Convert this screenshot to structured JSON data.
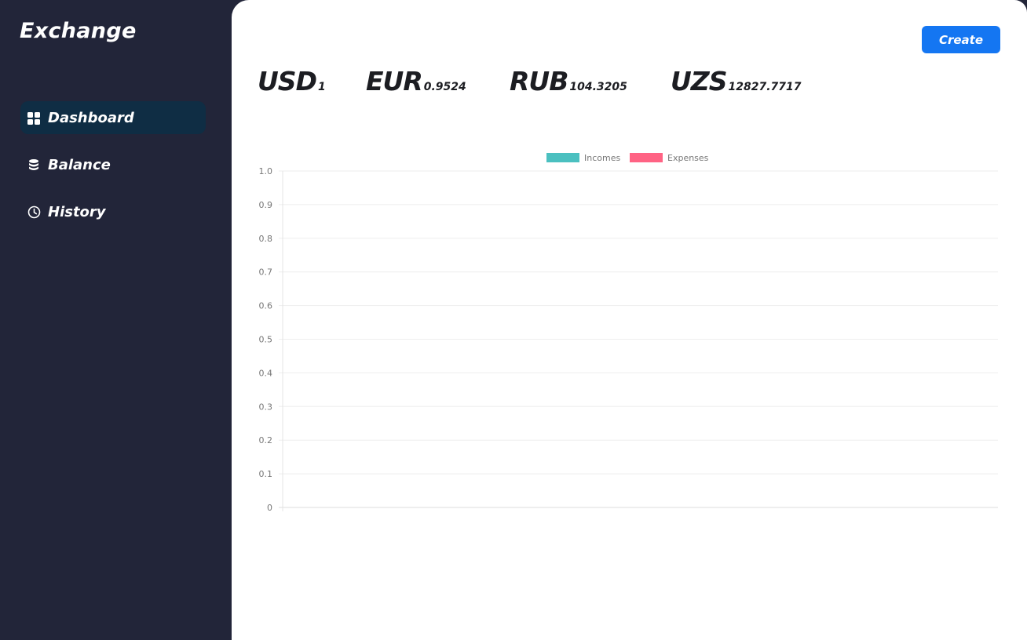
{
  "app": {
    "title": "Exchange"
  },
  "sidebar": {
    "items": [
      {
        "label": "Dashboard",
        "icon": "dashboard-grid-icon",
        "active": true
      },
      {
        "label": "Balance",
        "icon": "database-coins-icon",
        "active": false
      },
      {
        "label": "History",
        "icon": "clock-icon",
        "active": false
      }
    ]
  },
  "header": {
    "create_label": "Create"
  },
  "rates": [
    {
      "code": "USD",
      "value": "1"
    },
    {
      "code": "EUR",
      "value": "0.9524"
    },
    {
      "code": "RUB",
      "value": "104.3205"
    },
    {
      "code": "UZS",
      "value": "12827.7717"
    }
  ],
  "colors": {
    "sidebar_bg": "#222539",
    "active_item_bg": "#0f2d44",
    "accent": "#1476f2",
    "incomes": "#4bc0c0",
    "expenses": "#ff6384"
  },
  "chart_data": {
    "type": "bar",
    "categories": [],
    "series": [
      {
        "name": "Incomes",
        "values": []
      },
      {
        "name": "Expenses",
        "values": []
      }
    ],
    "ylim": [
      0,
      1
    ],
    "yticks": [
      "1.0",
      "0.9",
      "0.8",
      "0.7",
      "0.6",
      "0.5",
      "0.4",
      "0.3",
      "0.2",
      "0.1",
      "0"
    ],
    "grid": true,
    "legend": "top-center"
  }
}
